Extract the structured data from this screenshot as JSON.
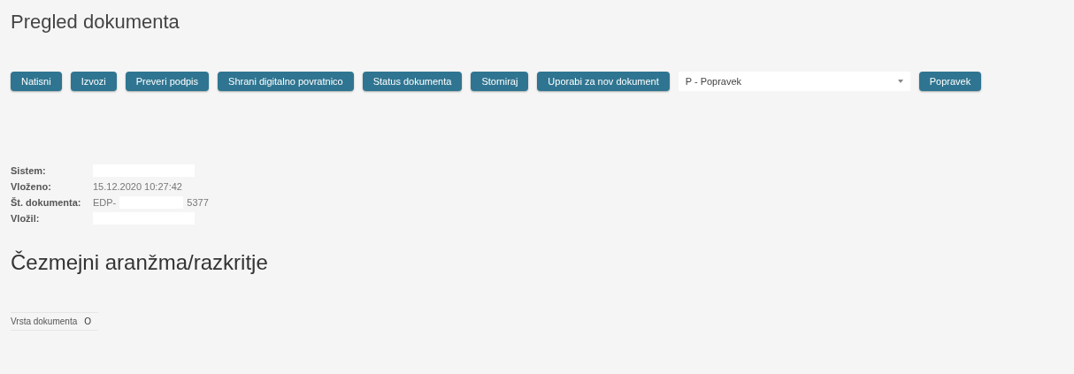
{
  "page_title": "Pregled dokumenta",
  "toolbar": {
    "buttons": [
      "Natisni",
      "Izvozi",
      "Preveri podpis",
      "Shrani digitalno povratnico",
      "Status dokumenta",
      "Storniraj",
      "Uporabi za nov dokument"
    ],
    "select": {
      "value": "P - Popravek"
    },
    "action_button": "Popravek"
  },
  "details": [
    {
      "label": "Sistem:",
      "kind": "redacted"
    },
    {
      "label": "Vloženo:",
      "kind": "text",
      "value": "15.12.2020 10:27:42"
    },
    {
      "label": "Št. dokumenta:",
      "kind": "partial",
      "prefix": "EDP-",
      "suffix": "5377"
    },
    {
      "label": "Vložil:",
      "kind": "redacted"
    }
  ],
  "section_title": "Čezmejni aranžma/razkritje",
  "fields": [
    {
      "label": "Vrsta dokumenta",
      "value": "O"
    }
  ]
}
